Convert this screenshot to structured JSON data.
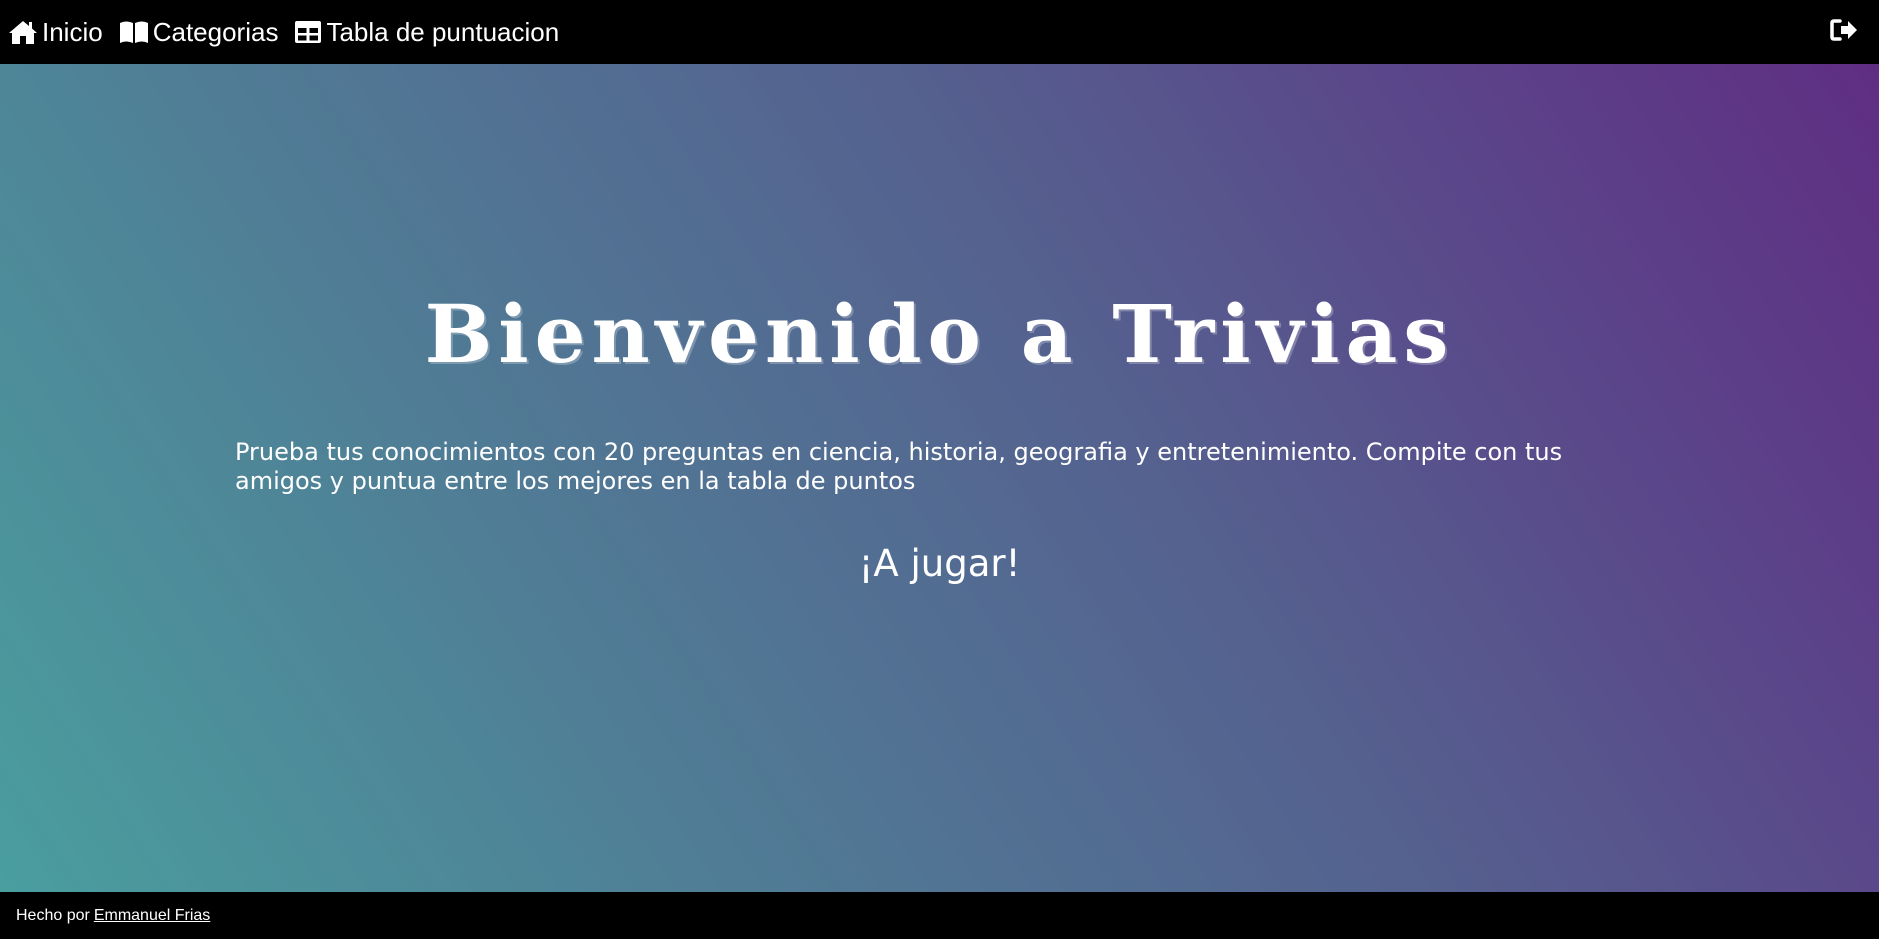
{
  "nav": {
    "items": [
      {
        "label": "Inicio",
        "icon": "home-icon"
      },
      {
        "label": "Categorias",
        "icon": "book-icon"
      },
      {
        "label": "Tabla de puntuacion",
        "icon": "table-icon"
      }
    ],
    "logout_icon": "sign-out-icon"
  },
  "hero": {
    "title": "Bienvenido a Trivias",
    "description": "Prueba tus conocimientos con 20 preguntas en ciencia, historia, geografia y entretenimiento. Compite con tus amigos y puntua entre los mejores en la tabla de puntos",
    "cta": "¡A jugar!"
  },
  "footer": {
    "prefix": "Hecho por",
    "author": "Emmanuel Frias"
  },
  "colors": {
    "nav_bg": "#000000",
    "gradient_start": "#4a9e9e",
    "gradient_end": "#5f2e83",
    "text": "#ffffff"
  }
}
